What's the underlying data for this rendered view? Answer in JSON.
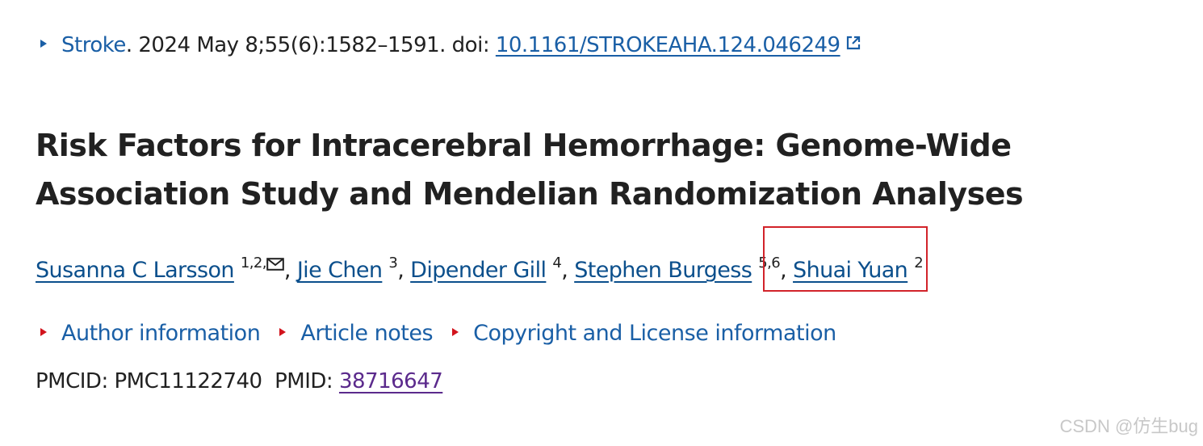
{
  "citation": {
    "journal": "Stroke",
    "details": ". 2024 May 8;55(6):1582–1591. doi: ",
    "doi": "10.1161/STROKEAHA.124.046249",
    "external_icon": "external-link-icon"
  },
  "article": {
    "title": "Risk Factors for Intracerebral Hemorrhage: Genome-Wide Association Study and Mendelian Randomization Analyses"
  },
  "authors": [
    {
      "name": "Susanna C Larsson",
      "sup": "1,2,",
      "has_mail": true
    },
    {
      "name": "Jie Chen",
      "sup": "3"
    },
    {
      "name": "Dipender Gill",
      "sup": "4"
    },
    {
      "name": "Stephen Burgess",
      "sup": "5,6"
    },
    {
      "name": "Shuai Yuan",
      "sup": "2"
    }
  ],
  "separator": ", ",
  "info_links": [
    {
      "label": "Author information"
    },
    {
      "label": "Article notes"
    },
    {
      "label": "Copyright and License information"
    }
  ],
  "ids": {
    "pmcid_label": "PMCID: ",
    "pmcid": "PMC11122740",
    "pmid_label": "PMID: ",
    "pmid": "38716647"
  },
  "watermark": "CSDN @仿生bug",
  "colors": {
    "link": "#1a5fa6",
    "visited": "#5b2a8c",
    "highlight": "#d2232a",
    "expand_arrow": "#d2141d"
  }
}
